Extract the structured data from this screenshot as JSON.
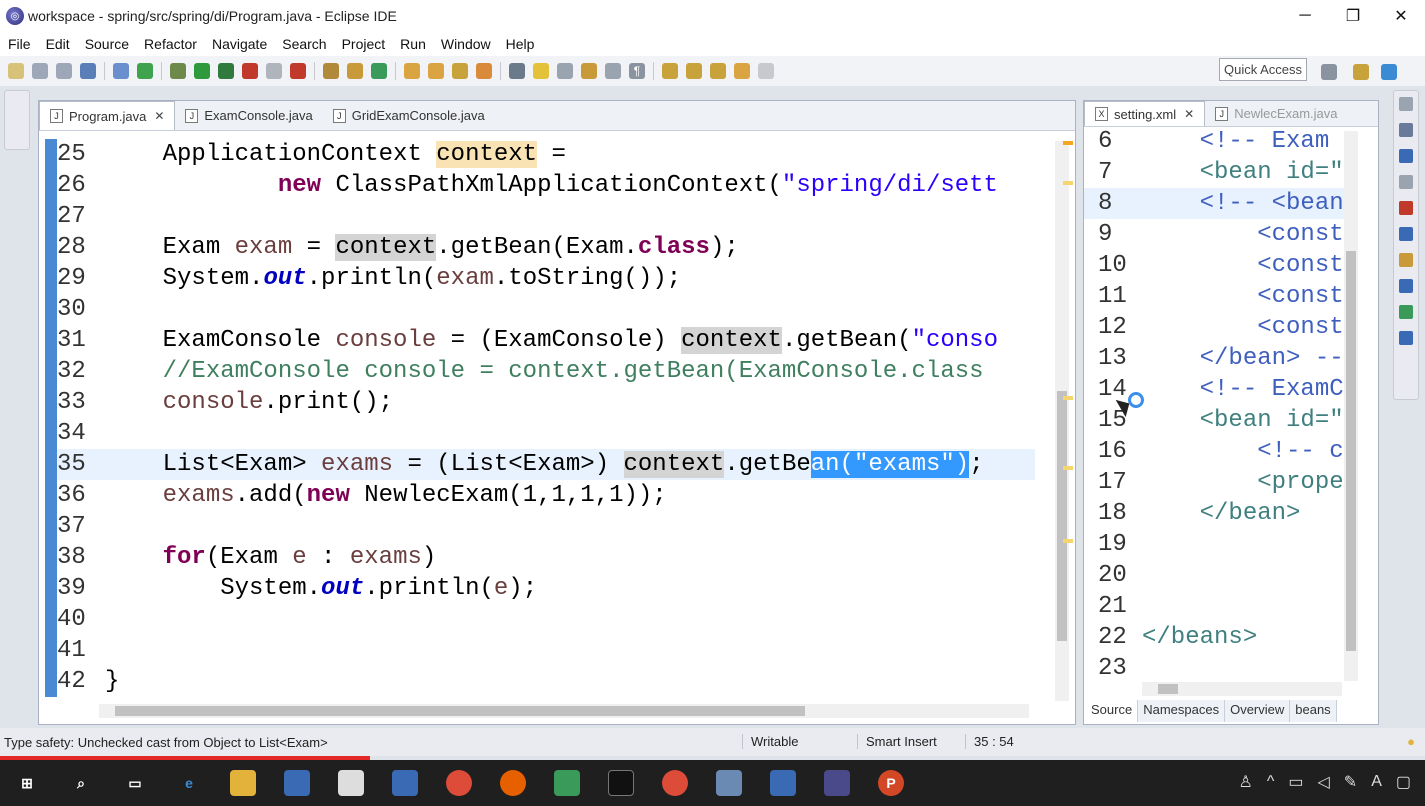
{
  "window": {
    "title": "workspace - spring/src/spring/di/Program.java - Eclipse IDE",
    "minimize": "─",
    "maximize": "❐",
    "close": "✕"
  },
  "menu": [
    "File",
    "Edit",
    "Source",
    "Refactor",
    "Navigate",
    "Search",
    "Project",
    "Run",
    "Window",
    "Help"
  ],
  "toolbar": {
    "quick_access": "Quick Access"
  },
  "editor": {
    "tabs": [
      {
        "label": "Program.java",
        "active": true,
        "closable": true
      },
      {
        "label": "ExamConsole.java",
        "active": false,
        "closable": false
      },
      {
        "label": "GridExamConsole.java",
        "active": false,
        "closable": false
      }
    ],
    "lines": [
      {
        "n": "25",
        "text": "    ApplicationContext context ="
      },
      {
        "n": "26",
        "text": "            new ClassPathXmlApplicationContext(\"spring/di/sett"
      },
      {
        "n": "27",
        "text": ""
      },
      {
        "n": "28",
        "text": "    Exam exam = context.getBean(Exam.class);"
      },
      {
        "n": "29",
        "text": "    System.out.println(exam.toString());"
      },
      {
        "n": "30",
        "text": ""
      },
      {
        "n": "31",
        "text": "    ExamConsole console = (ExamConsole) context.getBean(\"conso"
      },
      {
        "n": "32",
        "text": "    //ExamConsole console = context.getBean(ExamConsole.class"
      },
      {
        "n": "33",
        "text": "    console.print();"
      },
      {
        "n": "34",
        "text": ""
      },
      {
        "n": "35",
        "text": "    List<Exam> exams = (List<Exam>) context.getBean(\"exams\");"
      },
      {
        "n": "36",
        "text": "    exams.add(new NewlecExam(1,1,1,1));"
      },
      {
        "n": "37",
        "text": ""
      },
      {
        "n": "38",
        "text": "    for(Exam e : exams)"
      },
      {
        "n": "39",
        "text": "        System.out.println(e);"
      },
      {
        "n": "40",
        "text": ""
      },
      {
        "n": "41",
        "text": ""
      },
      {
        "n": "42",
        "text": "}"
      }
    ]
  },
  "xml": {
    "tabs": [
      {
        "label": "setting.xml",
        "active": true
      },
      {
        "label": "NewlecExam.java",
        "active": false
      }
    ],
    "lines": [
      {
        "n": "6",
        "text": "    <!-- Exam"
      },
      {
        "n": "7",
        "text": "    <bean id=\""
      },
      {
        "n": "8",
        "text": "    <!-- <bean"
      },
      {
        "n": "9",
        "text": "        <const"
      },
      {
        "n": "10",
        "text": "        <const"
      },
      {
        "n": "11",
        "text": "        <const"
      },
      {
        "n": "12",
        "text": "        <const"
      },
      {
        "n": "13",
        "text": "    </bean> --"
      },
      {
        "n": "14",
        "text": "    <!-- ExamC"
      },
      {
        "n": "15",
        "text": "    <bean id=\""
      },
      {
        "n": "16",
        "text": "        <!-- c"
      },
      {
        "n": "17",
        "text": "        <prope"
      },
      {
        "n": "18",
        "text": "    </bean>"
      },
      {
        "n": "19",
        "text": ""
      },
      {
        "n": "20",
        "text": ""
      },
      {
        "n": "21",
        "text": ""
      },
      {
        "n": "22",
        "text": "</beans>"
      },
      {
        "n": "23",
        "text": ""
      }
    ],
    "bottom_tabs": [
      "Source",
      "Namespaces",
      "Overview",
      "beans"
    ]
  },
  "status": {
    "message": "Type safety: Unchecked cast from Object to List<Exam>",
    "writable": "Writable",
    "insert_mode": "Smart Insert",
    "position": "35 : 54"
  },
  "colors": {
    "keyword": "#7f0055",
    "string": "#2a00ff",
    "comment": "#3f7f5f",
    "selection": "#3399ff"
  }
}
